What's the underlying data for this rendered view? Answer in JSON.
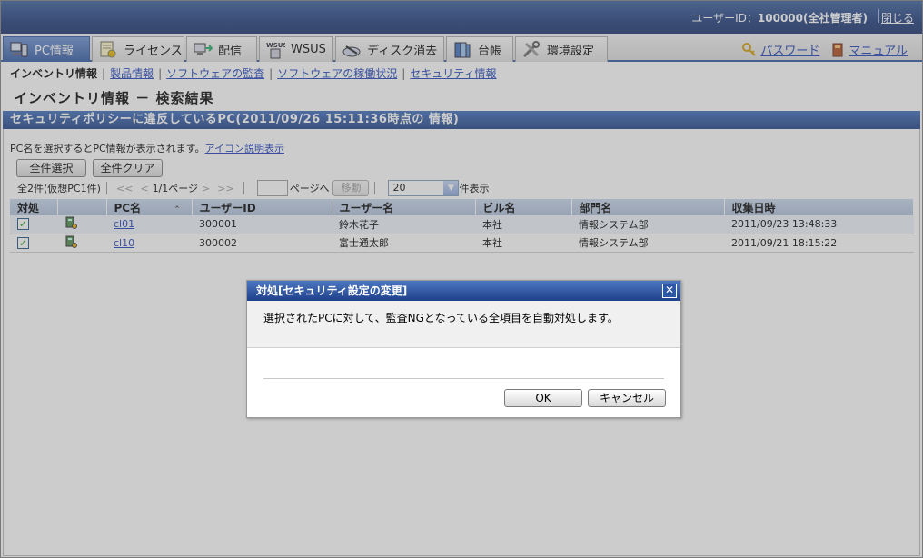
{
  "header": {
    "user_prefix": "ユーザーID：",
    "user_id": "100000",
    "user_role": "(全社管理者)",
    "close_label": "閉じる"
  },
  "tabs": [
    {
      "label": "PC情報",
      "icon": "pc-icon",
      "active": true
    },
    {
      "label": "ライセンス",
      "icon": "license-icon"
    },
    {
      "label": "配信",
      "icon": "distribution-icon"
    },
    {
      "label": "WSUS",
      "icon": "wsus-icon"
    },
    {
      "label": "ディスク消去",
      "icon": "disk-erase-icon"
    },
    {
      "label": "台帳",
      "icon": "ledger-icon"
    },
    {
      "label": "環境設定",
      "icon": "settings-icon"
    }
  ],
  "right_links": {
    "password": "パスワード",
    "manual": "マニュアル"
  },
  "subnav": {
    "current": "インベントリ情報",
    "items": [
      "製品情報",
      "ソフトウェアの監査",
      "ソフトウェアの稼働状況",
      "セキュリティ情報"
    ]
  },
  "page_title": "インベントリ情報 － 検索結果",
  "panel": {
    "title": "セキュリティポリシーに違反しているPC(2011/09/26 15:11:36時点の 情報)",
    "hint": "PC名を選択するとPC情報が表示されます。",
    "hint_link": "アイコン説明表示",
    "select_all": "全件選択",
    "clear_all": "全件クリア",
    "pager": {
      "count": "全2件(仮想PC1件)",
      "first": "<<",
      "prev": "<",
      "page_info": "1/1ページ",
      "next": ">",
      "last": ">>",
      "page_suffix": "ページへ",
      "move": "移動",
      "per_page": "20",
      "per_page_suffix": "件表示"
    },
    "columns": [
      "対処",
      "",
      "PC名",
      "ユーザーID",
      "ユーザー名",
      "ビル名",
      "部門名",
      "収集日時"
    ],
    "rows": [
      {
        "pc": "cl01",
        "user_id": "300001",
        "user_name": "鈴木花子",
        "building": "本社",
        "dept": "情報システム部",
        "date": "2011/09/23 13:48:33"
      },
      {
        "pc": "cl10",
        "user_id": "300002",
        "user_name": "富士通太郎",
        "building": "本社",
        "dept": "情報システム部",
        "date": "2011/09/21 18:15:22"
      }
    ]
  },
  "dialog": {
    "title": "対処[セキュリティ設定の変更]",
    "message": "選択されたPCに対して、監査NGとなっている全項目を自動対処します。",
    "ok": "OK",
    "cancel": "キャンセル"
  }
}
